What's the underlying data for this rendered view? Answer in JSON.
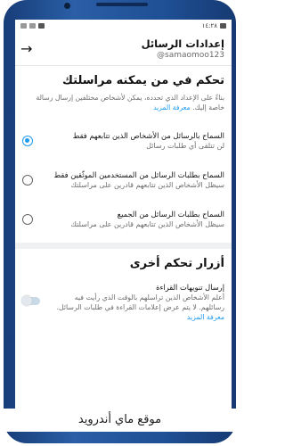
{
  "status_bar": {
    "time": "١٤:٢٨"
  },
  "header": {
    "title": "إعدادات الرسائل",
    "handle": "@samaomoo123",
    "back_icon": "arrow-right-icon"
  },
  "who_can_message": {
    "title": "تحكم في من يمكنه مراسلتك",
    "description": "بناءً على الإعداد الذي تحدده، يمكن لأشخاص مختلفين إرسال رسالة خاصة إليك.",
    "learn_more": "معرفة المزيد",
    "options": [
      {
        "title": "السماح بالرسائل من الأشخاص الذين تتابعهم فقط",
        "subtitle": "لن تتلقى أي طلبات رسائل",
        "selected": true
      },
      {
        "title": "السماح بطلبات الرسائل من المستخدمين الموثّقين فقط",
        "subtitle": "سيظل الأشخاص الذين تتابعهم قادرين على مراسلتك",
        "selected": false
      },
      {
        "title": "السماح بطلبات الرسائل من الجميع",
        "subtitle": "سيظل الأشخاص الذين تتابعهم قادرين على مراسلتك",
        "selected": false
      }
    ]
  },
  "other_controls": {
    "title": "أزرار تحكم أخرى",
    "read_receipts": {
      "title": "إرسال تنويهات القراءة",
      "description": "أعلم الأشخاص الذين تراسلهم بالوقت الذي رأيت فيه رسائلهم. لا يتم عرض إعلامات القراءة في طلبات الرسائل.",
      "learn_more": "معرفة المزيد",
      "enabled": false
    }
  },
  "footer": {
    "watermark": "موقع ماي أندرويد"
  },
  "colors": {
    "accent": "#1d9bf0",
    "phone_frame": "#1f4f94"
  }
}
